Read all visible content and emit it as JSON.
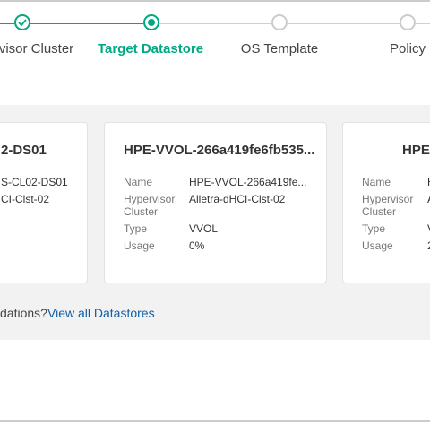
{
  "stepper": {
    "steps": [
      {
        "label": "rvisor Cluster",
        "state": "done"
      },
      {
        "label": "Target Datastore",
        "state": "current"
      },
      {
        "label": "OS Template",
        "state": "pending"
      },
      {
        "label": "Policy",
        "state": "pending"
      }
    ]
  },
  "cards": [
    {
      "title": "2-DS01",
      "rows": [
        {
          "value": "S-CL02-DS01"
        },
        {
          "value": "CI-Clst-02"
        }
      ]
    },
    {
      "title": "HPE-VVOL-266a419fe6fb535...",
      "rows": [
        {
          "label": "Name",
          "value": "HPE-VVOL-266a419fe..."
        },
        {
          "label": "Hypervisor Cluster",
          "label_line1": "Hypervisor",
          "label_line2": "Cluster",
          "value": "Alletra-dHCI-Clst-02"
        },
        {
          "label": "Type",
          "value": "VVOL"
        },
        {
          "label": "Usage",
          "value": "0%"
        }
      ]
    },
    {
      "title": "HPE-",
      "rows": [
        {
          "label": "Name",
          "value": "H"
        },
        {
          "label": "Hypervisor Cluster",
          "label_line1": "Hypervisor",
          "label_line2": "Cluster",
          "value": "A"
        },
        {
          "label": "Type",
          "value": "V"
        },
        {
          "label": "Usage",
          "value": "2"
        }
      ]
    }
  ],
  "footer": {
    "question": "dations?",
    "link": "View all Datastores"
  },
  "colors": {
    "accent": "#01a982",
    "link": "#0e5fa8",
    "panel_bg": "#f2f2f2"
  }
}
